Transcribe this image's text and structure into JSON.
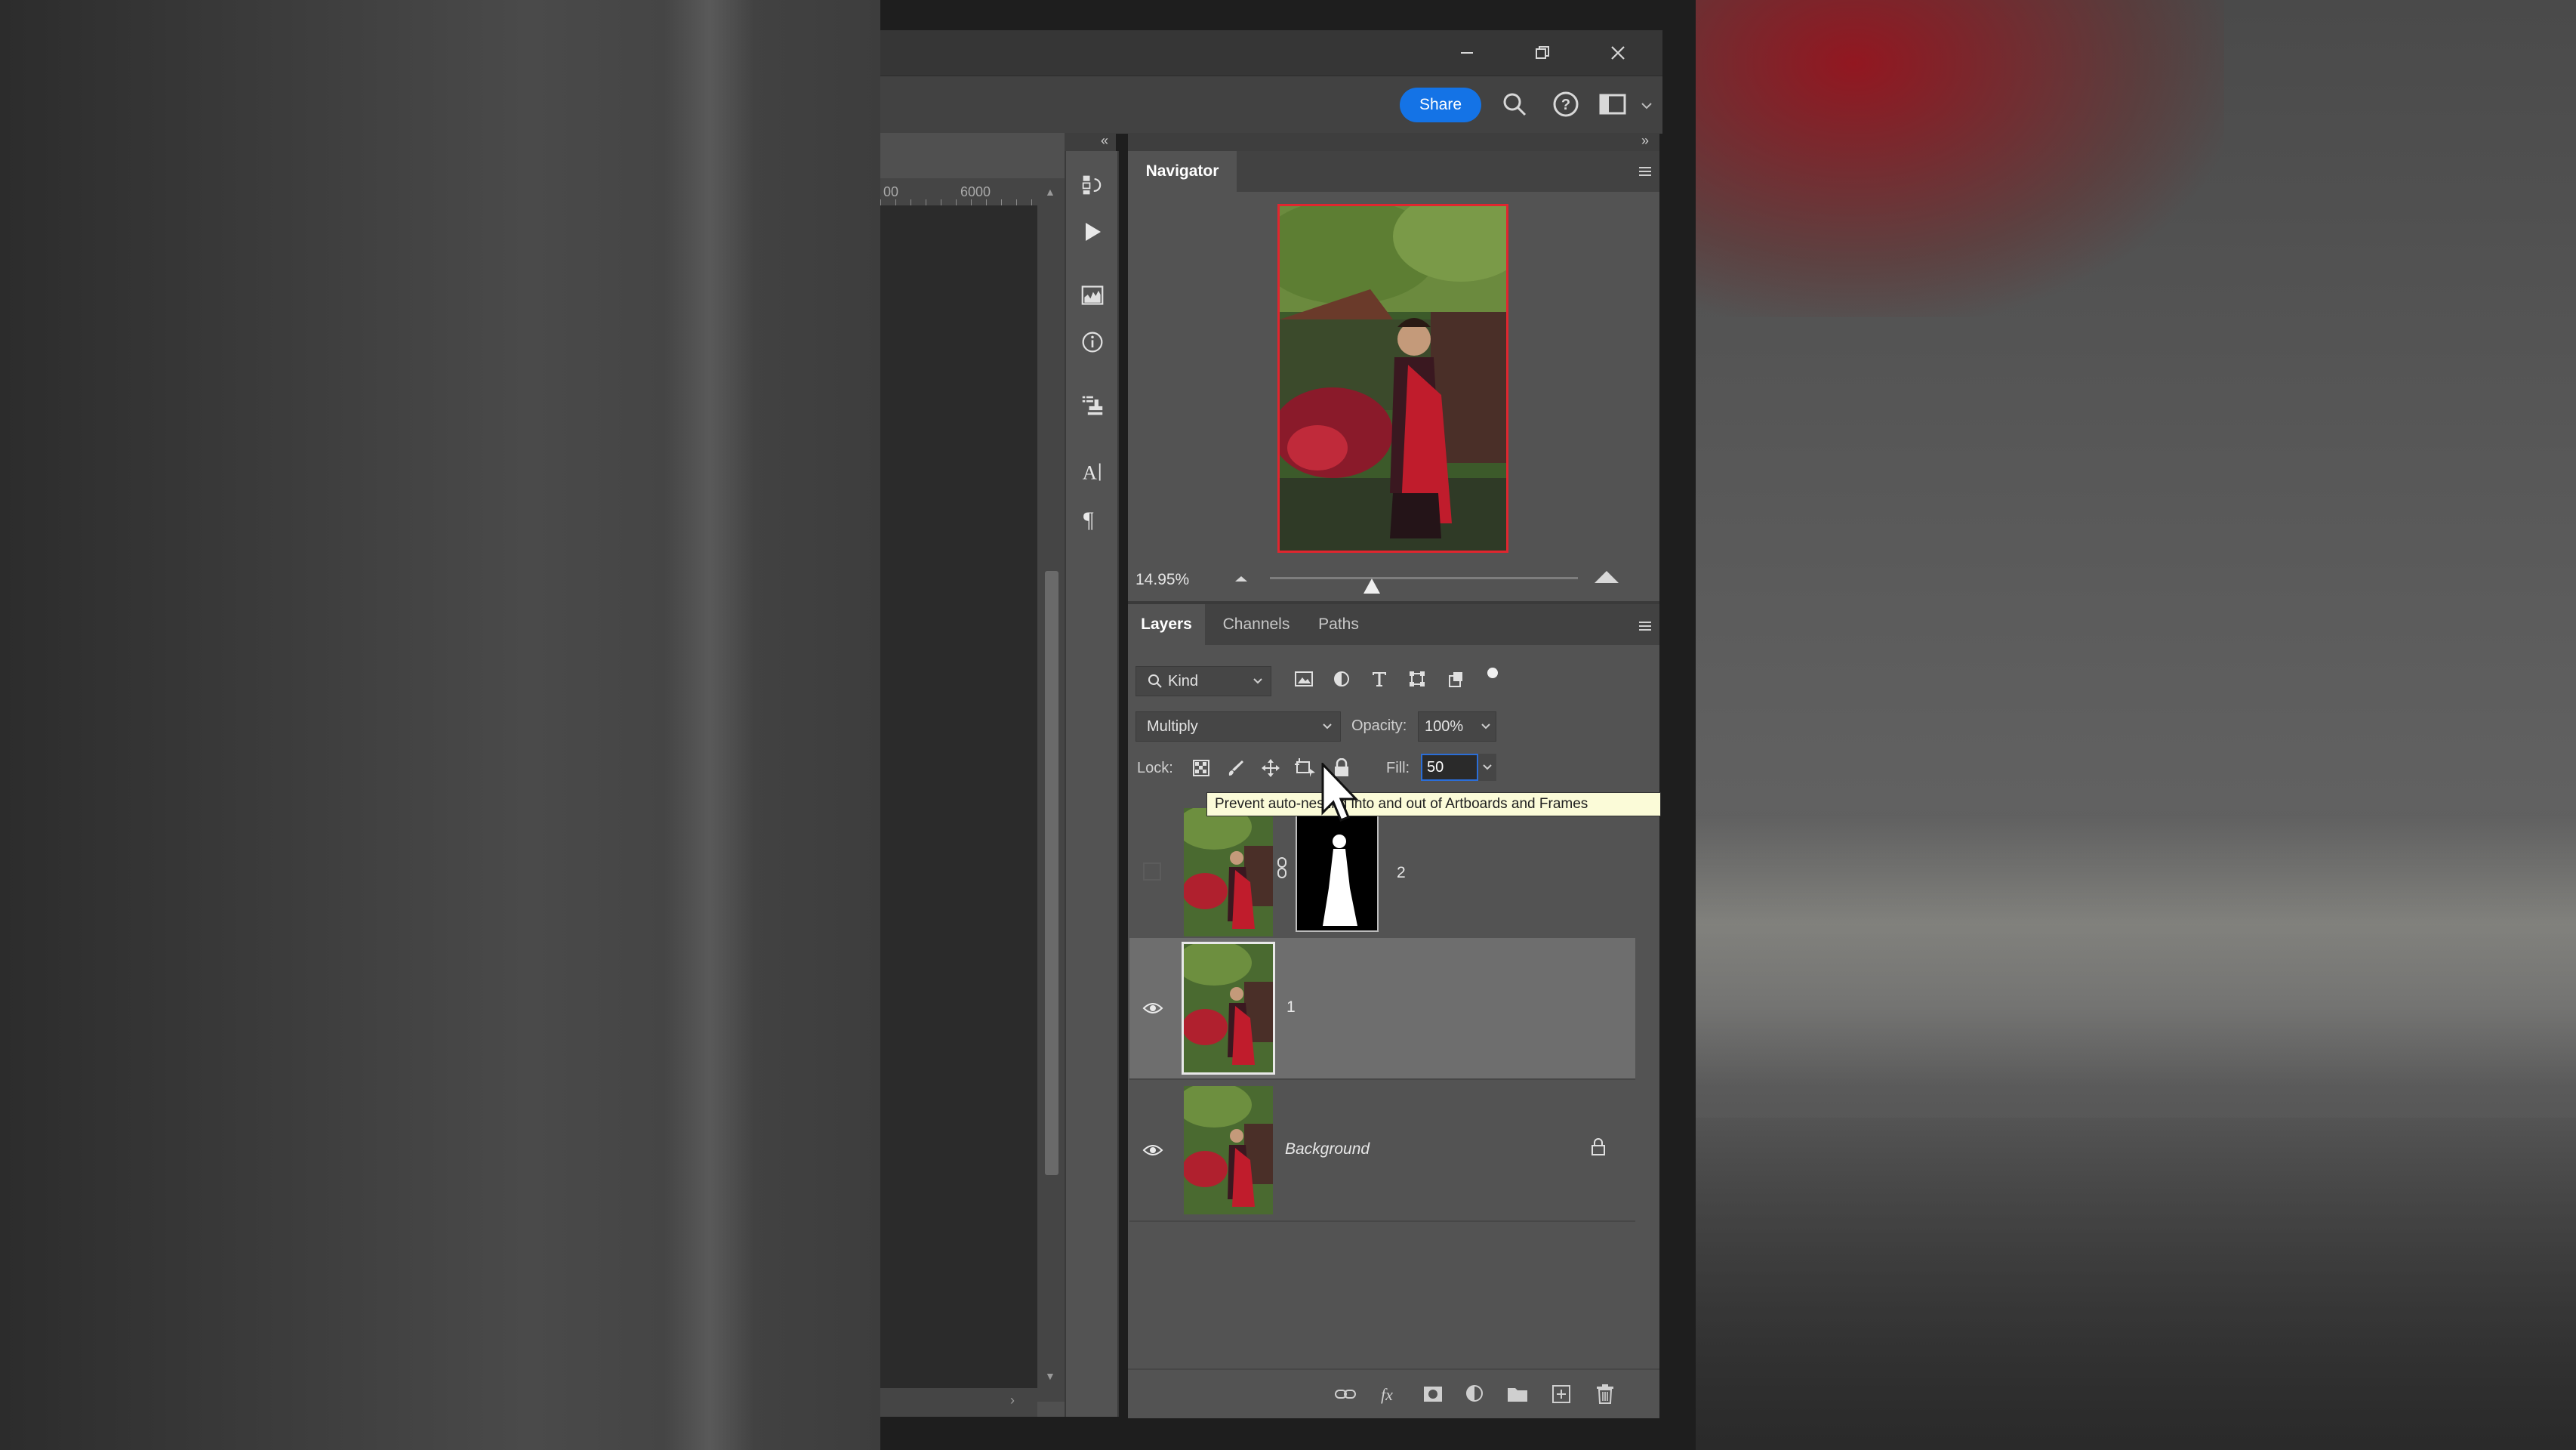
{
  "window": {
    "minimize_icon": "minimize-icon",
    "restore_icon": "restore-icon",
    "close_icon": "close-icon"
  },
  "toolbar": {
    "share_label": "Share",
    "search_icon": "search-icon",
    "help_icon": "help-icon",
    "workspace_icon": "workspace-icon"
  },
  "ruler": {
    "tick_a": "00",
    "tick_b": "6000"
  },
  "navigator": {
    "tab_label": "Navigator",
    "zoom_value": "14.95%",
    "zoom_fraction": 0.33
  },
  "layers_panel": {
    "tabs": [
      {
        "label": "Layers",
        "active": true
      },
      {
        "label": "Channels",
        "active": false
      },
      {
        "label": "Paths",
        "active": false
      }
    ],
    "filter": {
      "kind_label": "Kind"
    },
    "blend_mode": "Multiply",
    "opacity_label": "Opacity:",
    "opacity_value": "100%",
    "lock_label": "Lock:",
    "fill_label": "Fill:",
    "fill_value": "50",
    "tooltip": "Prevent auto-nesting into and out of Artboards and Frames",
    "layers": [
      {
        "name": "2",
        "visible": false,
        "has_mask": true,
        "selected": false
      },
      {
        "name": "1",
        "visible": true,
        "has_mask": false,
        "selected": true
      },
      {
        "name": "Background",
        "visible": true,
        "has_mask": false,
        "selected": false,
        "locked": true
      }
    ]
  },
  "colors": {
    "accent": "#1473e6",
    "panel_bg": "#535353",
    "selected_row": "#6e6e6e",
    "navigator_frame": "#e0262f"
  }
}
